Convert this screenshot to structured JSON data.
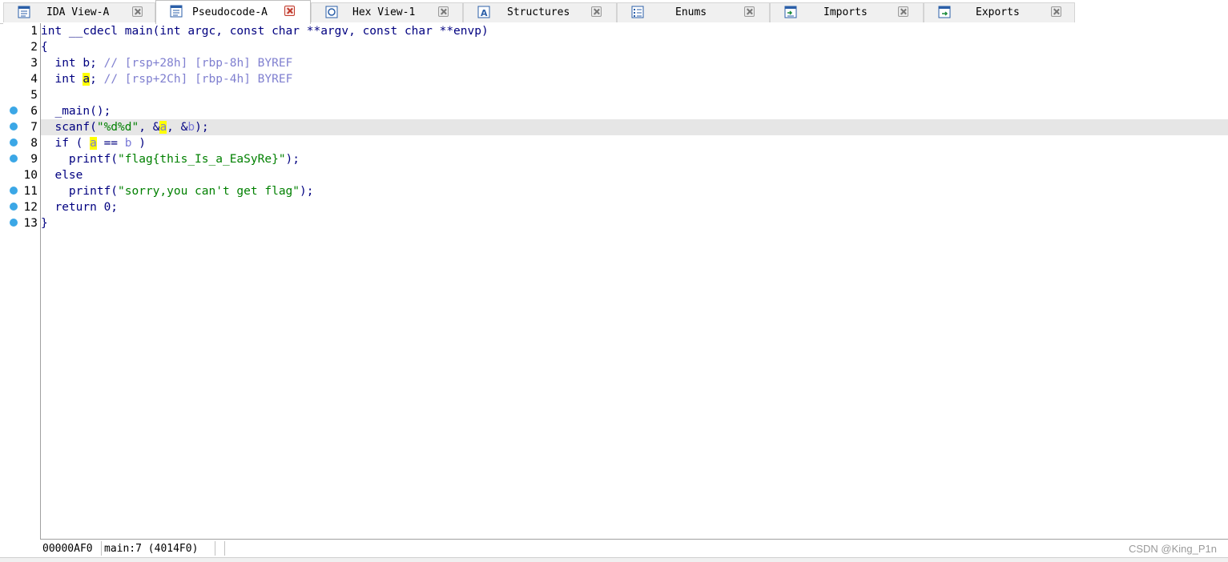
{
  "tabs": [
    {
      "label": "IDA View-A",
      "icon": "disassembly-icon",
      "active": false
    },
    {
      "label": "Pseudocode-A",
      "icon": "pseudocode-icon",
      "active": true
    },
    {
      "label": "Hex View-1",
      "icon": "hex-icon",
      "active": false
    },
    {
      "label": "Structures",
      "icon": "structures-icon",
      "active": false
    },
    {
      "label": "Enums",
      "icon": "enums-icon",
      "active": false
    },
    {
      "label": "Imports",
      "icon": "imports-icon",
      "active": false
    },
    {
      "label": "Exports",
      "icon": "exports-icon",
      "active": false
    }
  ],
  "code": {
    "line_numbers": [
      "1",
      "2",
      "3",
      "4",
      "5",
      "6",
      "7",
      "8",
      "9",
      "10",
      "11",
      "12",
      "13"
    ],
    "current_line": "7",
    "lines": {
      "l1": "int __cdecl main(int argc, const char **argv, const char **envp)",
      "l2": "{",
      "l3_decl": "  int b; ",
      "l3_comment": "// [rsp+28h] [rbp-8h] BYREF",
      "l4_a": "  int ",
      "l4_var": "a",
      "l4_b": "; ",
      "l4_comment": "// [rsp+2Ch] [rbp-4h] BYREF",
      "l5": "",
      "l6": "  _main();",
      "l7_a": "  scanf(",
      "l7_str": "\"%d%d\"",
      "l7_b": ", &",
      "l7_var_a": "a",
      "l7_c": ", &",
      "l7_var_b": "b",
      "l7_d": ");",
      "l8_a": "  if ( ",
      "l8_var_a": "a",
      "l8_b": " == ",
      "l8_var_b": "b",
      "l8_c": " )",
      "l9_a": "    printf(",
      "l9_str": "\"flag{this_Is_a_EaSyRe}\"",
      "l9_b": ");",
      "l10": "  else",
      "l11_a": "    printf(",
      "l11_str": "\"sorry,you can't get flag\"",
      "l11_b": ");",
      "l12": "  return 0;",
      "l13": "}"
    },
    "breakpoint_lines": [
      "6",
      "7",
      "8",
      "9",
      "11",
      "12",
      "13"
    ]
  },
  "status": {
    "offset": "00000AF0",
    "location": "main:7 (4014F0)",
    "watermark": "CSDN @King_P1n"
  },
  "colors": {
    "keyword": "#000080",
    "comment": "#8080d0",
    "string": "#008000",
    "highlight": "#ffff00",
    "current_line_bg": "#e6e6e6",
    "breakpoint_dot": "#3ba7e6"
  }
}
